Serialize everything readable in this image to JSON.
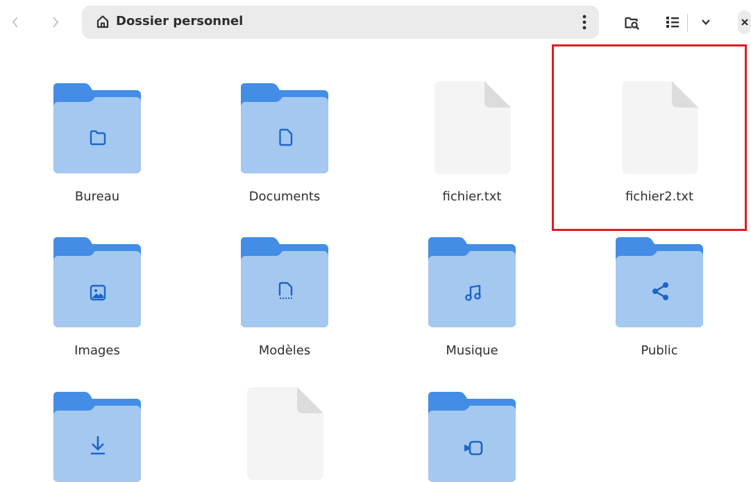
{
  "toolbar": {
    "path": {
      "location": "Dossier personnel",
      "icon": "home-icon"
    },
    "buttons": [
      "back-icon",
      "forward-icon",
      "more-options-icon",
      "search-folder-icon",
      "list-view-icon",
      "chevron-down-icon",
      "close-icon"
    ]
  },
  "items": [
    {
      "name": "Bureau",
      "type": "folder",
      "emblem": "folder-icon"
    },
    {
      "name": "Documents",
      "type": "folder",
      "emblem": "document-icon"
    },
    {
      "name": "fichier.txt",
      "type": "file"
    },
    {
      "name": "fichier2.txt",
      "type": "file",
      "highlighted": true
    },
    {
      "name": "Images",
      "type": "folder",
      "emblem": "image-icon"
    },
    {
      "name": "Modèles",
      "type": "folder",
      "emblem": "template-icon"
    },
    {
      "name": "Musique",
      "type": "folder",
      "emblem": "music-icon"
    },
    {
      "name": "Public",
      "type": "folder",
      "emblem": "share-icon"
    },
    {
      "name": "",
      "type": "folder",
      "emblem": "download-icon"
    },
    {
      "name": "",
      "type": "file"
    },
    {
      "name": "",
      "type": "folder",
      "emblem": "video-icon"
    }
  ],
  "colors": {
    "folder_front": "#a4c8ef",
    "folder_back": "#438de6",
    "emblem": "#1c65c7",
    "file": "#f4f4f4",
    "file_fold": "#dcdcdc",
    "highlight": "#e01b24"
  }
}
